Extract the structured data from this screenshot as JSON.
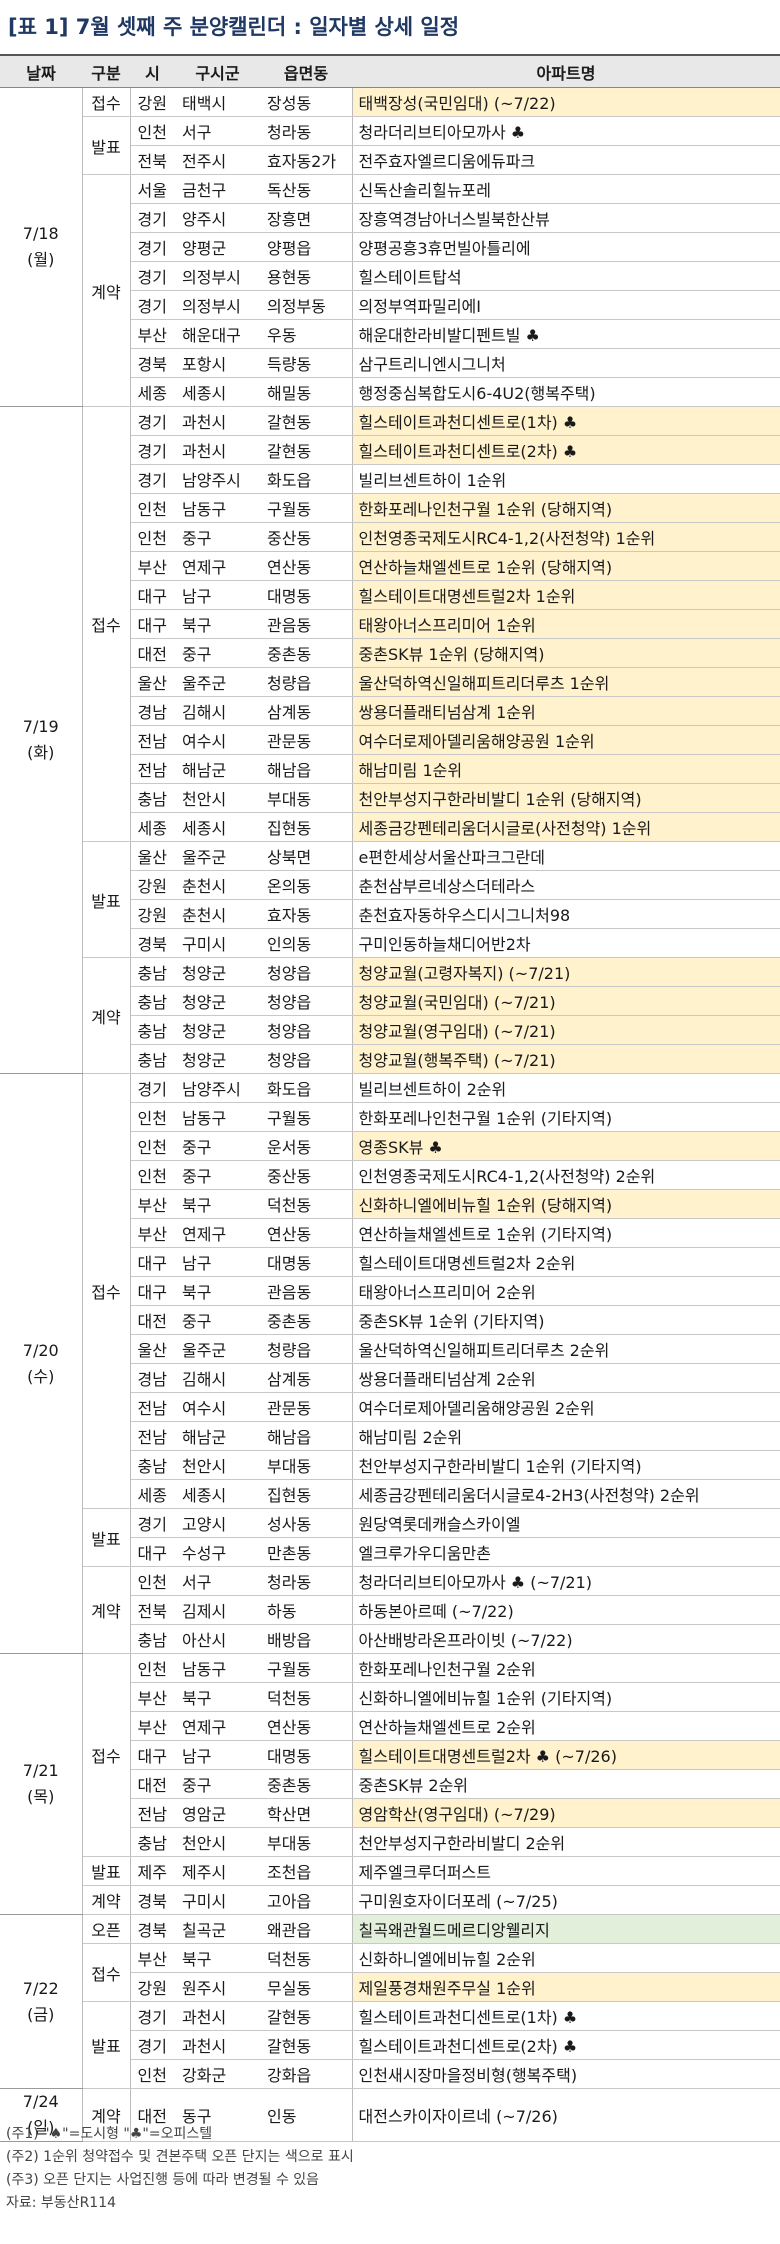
{
  "title": "[표 1] 7월 셋째 주 분양캘린더 : 일자별 상세 일정",
  "columns": [
    "날짜",
    "구분",
    "시",
    "구시군",
    "읍면동",
    "아파트명"
  ],
  "groups": [
    {
      "date": "7/18",
      "day": "(월)",
      "sections": [
        {
          "type": "접수",
          "rows": [
            [
              "강원",
              "태백시",
              "장성동",
              "태백장성(국민임대) (~7/22)",
              1
            ]
          ]
        },
        {
          "type": "발표",
          "rows": [
            [
              "인천",
              "서구",
              "청라동",
              "청라더리브티아모까사 ♣",
              0
            ],
            [
              "전북",
              "전주시",
              "효자동2가",
              "전주효자엘르디움에듀파크",
              0
            ]
          ]
        },
        {
          "type": "계약",
          "rows": [
            [
              "서울",
              "금천구",
              "독산동",
              "신독산솔리힐뉴포레",
              0
            ],
            [
              "경기",
              "양주시",
              "장흥면",
              "장흥역경남아너스빌북한산뷰",
              0
            ],
            [
              "경기",
              "양평군",
              "양평읍",
              "양평공흥3휴먼빌아틀리에",
              0
            ],
            [
              "경기",
              "의정부시",
              "용현동",
              "힐스테이트탑석",
              0
            ],
            [
              "경기",
              "의정부시",
              "의정부동",
              "의정부역파밀리에Ⅰ",
              0
            ],
            [
              "부산",
              "해운대구",
              "우동",
              "해운대한라비발디펜트빌 ♣",
              0
            ],
            [
              "경북",
              "포항시",
              "득량동",
              "삼구트리니엔시그니처",
              0
            ],
            [
              "세종",
              "세종시",
              "해밀동",
              "행정중심복합도시6-4U2(행복주택)",
              0
            ]
          ]
        }
      ]
    },
    {
      "date": "7/19",
      "day": "(화)",
      "sections": [
        {
          "type": "접수",
          "rows": [
            [
              "경기",
              "과천시",
              "갈현동",
              "힐스테이트과천디센트로(1차) ♣",
              1
            ],
            [
              "경기",
              "과천시",
              "갈현동",
              "힐스테이트과천디센트로(2차) ♣",
              1
            ],
            [
              "경기",
              "남양주시",
              "화도읍",
              "빌리브센트하이 1순위",
              0
            ],
            [
              "인천",
              "남동구",
              "구월동",
              "한화포레나인천구월 1순위 (당해지역)",
              1
            ],
            [
              "인천",
              "중구",
              "중산동",
              "인천영종국제도시RC4-1,2(사전청약) 1순위",
              1
            ],
            [
              "부산",
              "연제구",
              "연산동",
              "연산하늘채엘센트로 1순위 (당해지역)",
              1
            ],
            [
              "대구",
              "남구",
              "대명동",
              "힐스테이트대명센트럴2차 1순위",
              1
            ],
            [
              "대구",
              "북구",
              "관음동",
              "태왕아너스프리미어 1순위",
              1
            ],
            [
              "대전",
              "중구",
              "중촌동",
              "중촌SK뷰 1순위 (당해지역)",
              1
            ],
            [
              "울산",
              "울주군",
              "청량읍",
              "울산덕하역신일해피트리더루츠 1순위",
              1
            ],
            [
              "경남",
              "김해시",
              "삼계동",
              "쌍용더플래티넘삼계 1순위",
              1
            ],
            [
              "전남",
              "여수시",
              "관문동",
              "여수더로제아델리움해양공원 1순위",
              1
            ],
            [
              "전남",
              "해남군",
              "해남읍",
              "해남미림 1순위",
              1
            ],
            [
              "충남",
              "천안시",
              "부대동",
              "천안부성지구한라비발디 1순위 (당해지역)",
              1
            ],
            [
              "세종",
              "세종시",
              "집현동",
              "세종금강펜테리움더시글로(사전청약) 1순위",
              1
            ]
          ]
        },
        {
          "type": "발표",
          "rows": [
            [
              "울산",
              "울주군",
              "상북면",
              "e편한세상서울산파크그란데",
              0
            ],
            [
              "강원",
              "춘천시",
              "온의동",
              "춘천삼부르네상스더테라스",
              0
            ],
            [
              "강원",
              "춘천시",
              "효자동",
              "춘천효자동하우스디시그니처98",
              0
            ],
            [
              "경북",
              "구미시",
              "인의동",
              "구미인동하늘채디어반2차",
              0
            ]
          ]
        },
        {
          "type": "계약",
          "rows": [
            [
              "충남",
              "청양군",
              "청양읍",
              "청양교월(고령자복지) (~7/21)",
              1
            ],
            [
              "충남",
              "청양군",
              "청양읍",
              "청양교월(국민임대) (~7/21)",
              1
            ],
            [
              "충남",
              "청양군",
              "청양읍",
              "청양교월(영구임대) (~7/21)",
              1
            ],
            [
              "충남",
              "청양군",
              "청양읍",
              "청양교월(행복주택) (~7/21)",
              1
            ]
          ]
        }
      ]
    },
    {
      "date": "7/20",
      "day": "(수)",
      "sections": [
        {
          "type": "접수",
          "rows": [
            [
              "경기",
              "남양주시",
              "화도읍",
              "빌리브센트하이 2순위",
              0
            ],
            [
              "인천",
              "남동구",
              "구월동",
              "한화포레나인천구월 1순위 (기타지역)",
              0
            ],
            [
              "인천",
              "중구",
              "운서동",
              "영종SK뷰 ♣",
              1
            ],
            [
              "인천",
              "중구",
              "중산동",
              "인천영종국제도시RC4-1,2(사전청약) 2순위",
              0
            ],
            [
              "부산",
              "북구",
              "덕천동",
              "신화하니엘에비뉴힐 1순위 (당해지역)",
              1
            ],
            [
              "부산",
              "연제구",
              "연산동",
              "연산하늘채엘센트로 1순위 (기타지역)",
              0
            ],
            [
              "대구",
              "남구",
              "대명동",
              "힐스테이트대명센트럴2차 2순위",
              0
            ],
            [
              "대구",
              "북구",
              "관음동",
              "태왕아너스프리미어 2순위",
              0
            ],
            [
              "대전",
              "중구",
              "중촌동",
              "중촌SK뷰 1순위 (기타지역)",
              0
            ],
            [
              "울산",
              "울주군",
              "청량읍",
              "울산덕하역신일해피트리더루츠 2순위",
              0
            ],
            [
              "경남",
              "김해시",
              "삼계동",
              "쌍용더플래티넘삼계 2순위",
              0
            ],
            [
              "전남",
              "여수시",
              "관문동",
              "여수더로제아델리움해양공원 2순위",
              0
            ],
            [
              "전남",
              "해남군",
              "해남읍",
              "해남미림 2순위",
              0
            ],
            [
              "충남",
              "천안시",
              "부대동",
              "천안부성지구한라비발디 1순위 (기타지역)",
              0
            ],
            [
              "세종",
              "세종시",
              "집현동",
              "세종금강펜테리움더시글로4-2H3(사전청약) 2순위",
              0
            ]
          ]
        },
        {
          "type": "발표",
          "rows": [
            [
              "경기",
              "고양시",
              "성사동",
              "원당역롯데캐슬스카이엘",
              0
            ],
            [
              "대구",
              "수성구",
              "만촌동",
              "엘크루가우디움만촌",
              0
            ]
          ]
        },
        {
          "type": "계약",
          "rows": [
            [
              "인천",
              "서구",
              "청라동",
              "청라더리브티아모까사 ♣ (~7/21)",
              0
            ],
            [
              "전북",
              "김제시",
              "하동",
              "하동본아르떼 (~7/22)",
              0
            ],
            [
              "충남",
              "아산시",
              "배방읍",
              "아산배방라온프라이빗 (~7/22)",
              0
            ]
          ]
        }
      ]
    },
    {
      "date": "7/21",
      "day": "(목)",
      "sections": [
        {
          "type": "접수",
          "rows": [
            [
              "인천",
              "남동구",
              "구월동",
              "한화포레나인천구월 2순위",
              0
            ],
            [
              "부산",
              "북구",
              "덕천동",
              "신화하니엘에비뉴힐 1순위 (기타지역)",
              0
            ],
            [
              "부산",
              "연제구",
              "연산동",
              "연산하늘채엘센트로 2순위",
              0
            ],
            [
              "대구",
              "남구",
              "대명동",
              "힐스테이트대명센트럴2차 ♣ (~7/26)",
              1
            ],
            [
              "대전",
              "중구",
              "중촌동",
              "중촌SK뷰 2순위",
              0
            ],
            [
              "전남",
              "영암군",
              "학산면",
              "영암학산(영구임대) (~7/29)",
              1
            ],
            [
              "충남",
              "천안시",
              "부대동",
              "천안부성지구한라비발디 2순위",
              0
            ]
          ]
        },
        {
          "type": "발표",
          "rows": [
            [
              "제주",
              "제주시",
              "조천읍",
              "제주엘크루더퍼스트",
              0
            ]
          ]
        },
        {
          "type": "계약",
          "rows": [
            [
              "경북",
              "구미시",
              "고아읍",
              "구미원호자이더포레 (~7/25)",
              0
            ]
          ]
        }
      ]
    },
    {
      "date": "7/22",
      "day": "(금)",
      "sections": [
        {
          "type": "오픈",
          "rows": [
            [
              "경북",
              "칠곡군",
              "왜관읍",
              "칠곡왜관월드메르디앙웰리지",
              2
            ]
          ]
        },
        {
          "type": "접수",
          "rows": [
            [
              "부산",
              "북구",
              "덕천동",
              "신화하니엘에비뉴힐 2순위",
              0
            ],
            [
              "강원",
              "원주시",
              "무실동",
              "제일풍경채원주무실 1순위",
              1
            ]
          ]
        },
        {
          "type": "발표",
          "rows": [
            [
              "경기",
              "과천시",
              "갈현동",
              "힐스테이트과천디센트로(1차) ♣",
              0
            ],
            [
              "경기",
              "과천시",
              "갈현동",
              "힐스테이트과천디센트로(2차) ♣",
              0
            ],
            [
              "인천",
              "강화군",
              "강화읍",
              "인천새시장마을정비형(행복주택)",
              0
            ]
          ]
        }
      ]
    },
    {
      "date": "7/24",
      "day": "(일)",
      "sections": [
        {
          "type": "계약",
          "rows": [
            [
              "대전",
              "동구",
              "인동",
              "대전스카이자이르네 (~7/26)",
              0
            ]
          ]
        }
      ]
    }
  ],
  "notes": [
    "(주1) \"♠\"=도시형 \"♣\"=오피스텔",
    "(주2) 1순위 청약접수 및 견본주택 오픈 단지는 색으로 표시",
    "(주3) 오픈 단지는 사업진행 등에 따라 변경될 수 있음",
    "자료: 부동산R114"
  ]
}
